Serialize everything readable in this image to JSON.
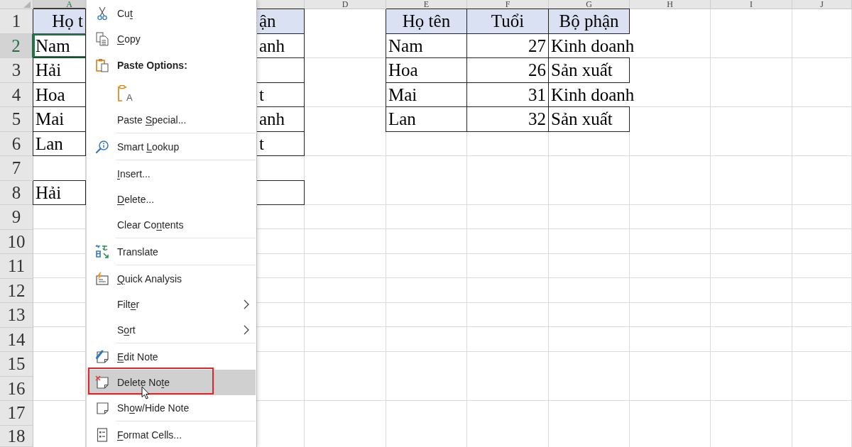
{
  "sheet": {
    "column_headers": [
      {
        "label": "A",
        "selected": true
      },
      {
        "selected": false
      },
      {
        "label": "D",
        "selected": false
      },
      {
        "label": "E",
        "selected": false
      },
      {
        "label": "F",
        "selected": false
      },
      {
        "label": "G",
        "selected": false
      },
      {
        "label": "H",
        "selected": false
      },
      {
        "label": "I",
        "selected": false
      },
      {
        "label": "J",
        "selected": false
      }
    ],
    "rows": [
      {
        "number": "1",
        "selected": false
      },
      {
        "number": "2",
        "selected": true
      },
      {
        "number": "3",
        "selected": false
      },
      {
        "number": "4",
        "selected": false
      },
      {
        "number": "5",
        "selected": false
      },
      {
        "number": "6",
        "selected": false
      },
      {
        "number": "7",
        "selected": false
      },
      {
        "number": "8",
        "selected": false
      },
      {
        "number": "9",
        "selected": false
      },
      {
        "number": "10",
        "selected": false
      },
      {
        "number": "11",
        "selected": false
      },
      {
        "number": "12",
        "selected": false
      },
      {
        "number": "13",
        "selected": false
      },
      {
        "number": "14",
        "selected": false
      },
      {
        "number": "15",
        "selected": false
      },
      {
        "number": "16",
        "selected": false
      },
      {
        "number": "17",
        "selected": false
      },
      {
        "number": "18",
        "selected": false
      }
    ],
    "tables": [
      {
        "rows": [
          {
            "kind": "header",
            "cells": [
              {
                "text": "Họ t",
                "kind": "clipped",
                "selected": false,
                "spills": false
              },
              {
                "text": "ận",
                "kind": "clipped",
                "selected": false,
                "spills": false
              }
            ]
          },
          {
            "kind": "data",
            "cells": [
              {
                "text": "Nam",
                "kind": "text",
                "selected": true,
                "spills": false
              },
              {
                "text": "anh",
                "kind": "clipped",
                "selected": false,
                "spills": false
              }
            ]
          },
          {
            "kind": "data",
            "cells": [
              {
                "text": "Hải",
                "kind": "text",
                "selected": false,
                "spills": false
              }
            ]
          },
          {
            "kind": "data",
            "cells": [
              {
                "text": "Hoa",
                "kind": "text",
                "selected": false,
                "spills": false
              },
              {
                "text": "t",
                "kind": "clipped",
                "selected": false,
                "spills": false
              }
            ]
          },
          {
            "kind": "data",
            "cells": [
              {
                "text": "Mai",
                "kind": "text",
                "selected": false,
                "spills": false
              },
              {
                "text": "anh",
                "kind": "clipped",
                "selected": false,
                "spills": false
              }
            ]
          },
          {
            "kind": "data",
            "cells": [
              {
                "text": "Lan",
                "kind": "text",
                "selected": false,
                "spills": false
              },
              {
                "text": "t",
                "kind": "clipped",
                "selected": false,
                "spills": false
              }
            ]
          }
        ]
      },
      {
        "rows": [
          {
            "kind": "data",
            "cells": [
              {
                "text": "Hải",
                "kind": "text",
                "selected": false,
                "spills": false
              }
            ]
          }
        ]
      },
      {
        "rows": [
          {
            "kind": "header",
            "cells": [
              {
                "text": "Họ tên",
                "kind": "title",
                "selected": false,
                "spills": false
              },
              {
                "text": "Tuổi",
                "kind": "title",
                "selected": false,
                "spills": false
              },
              {
                "text": "Bộ phận",
                "kind": "title",
                "selected": false,
                "spills": false
              }
            ]
          },
          {
            "kind": "data",
            "cells": [
              {
                "text": "Nam",
                "kind": "text",
                "selected": false,
                "spills": false
              },
              {
                "text": "27",
                "kind": "number",
                "selected": false,
                "spills": false
              },
              {
                "text": "Kinh doanh",
                "kind": "text",
                "selected": false,
                "spills": true
              }
            ]
          },
          {
            "kind": "data",
            "cells": [
              {
                "text": "Hoa",
                "kind": "text",
                "selected": false,
                "spills": false
              },
              {
                "text": "26",
                "kind": "number",
                "selected": false,
                "spills": false
              },
              {
                "text": "Sản xuất",
                "kind": "text",
                "selected": false,
                "spills": false
              }
            ]
          },
          {
            "kind": "data",
            "cells": [
              {
                "text": "Mai",
                "kind": "text",
                "selected": false,
                "spills": false
              },
              {
                "text": "31",
                "kind": "number",
                "selected": false,
                "spills": false
              },
              {
                "text": "Kinh doanh",
                "kind": "text",
                "selected": false,
                "spills": true
              }
            ]
          },
          {
            "kind": "data",
            "cells": [
              {
                "text": "Lan",
                "kind": "text",
                "selected": false,
                "spills": false
              },
              {
                "text": "32",
                "kind": "number",
                "selected": false,
                "spills": false
              },
              {
                "text": "Sản xuất",
                "kind": "text",
                "selected": false,
                "spills": false
              }
            ]
          }
        ]
      }
    ]
  },
  "context_menu": {
    "items": [
      {
        "kind": "command",
        "label_start": "Cu",
        "access_key": "t",
        "selected": false,
        "submenu": false,
        "framed": false
      },
      {
        "kind": "command",
        "access_key": "C",
        "label_end": "opy",
        "selected": false,
        "submenu": false,
        "framed": false
      },
      {
        "kind": "heading",
        "label": "Paste Options:"
      },
      {
        "kind": "paste-options",
        "options": [
          {
            "glyph": "A"
          }
        ]
      },
      {
        "kind": "command",
        "label_start": "Paste ",
        "access_key": "S",
        "label_end": "pecial...",
        "selected": false,
        "submenu": false,
        "framed": false
      },
      {
        "kind": "separator"
      },
      {
        "kind": "command",
        "label_start": "Smart ",
        "access_key": "L",
        "label_end": "ookup",
        "selected": false,
        "submenu": false,
        "framed": false
      },
      {
        "kind": "separator"
      },
      {
        "kind": "command",
        "access_key": "I",
        "label_end": "nsert...",
        "selected": false,
        "submenu": false,
        "framed": false
      },
      {
        "kind": "command",
        "access_key": "D",
        "label_end": "elete...",
        "selected": false,
        "submenu": false,
        "framed": false
      },
      {
        "kind": "command",
        "label_start": "Clear Co",
        "access_key": "n",
        "label_end": "tents",
        "selected": false,
        "submenu": false,
        "framed": false
      },
      {
        "kind": "separator"
      },
      {
        "kind": "command",
        "label_start": "Translate",
        "selected": false,
        "submenu": false,
        "framed": false
      },
      {
        "kind": "separator"
      },
      {
        "kind": "command",
        "access_key": "Q",
        "label_end": "uick Analysis",
        "selected": false,
        "submenu": false,
        "framed": false
      },
      {
        "kind": "command",
        "label_start": "Filt",
        "access_key": "e",
        "label_end": "r",
        "selected": false,
        "submenu": true,
        "framed": false
      },
      {
        "kind": "command",
        "label_start": "S",
        "access_key": "o",
        "label_end": "rt",
        "selected": false,
        "submenu": true,
        "framed": false
      },
      {
        "kind": "separator"
      },
      {
        "kind": "command",
        "access_key": "E",
        "label_end": "dit Note",
        "selected": false,
        "submenu": false,
        "framed": false
      },
      {
        "kind": "command",
        "label_start": "Delete No",
        "access_key": "t",
        "label_end": "e",
        "selected": true,
        "submenu": false,
        "framed": true
      },
      {
        "kind": "command",
        "label_start": "Sh",
        "access_key": "o",
        "label_end": "w/Hide Note",
        "selected": false,
        "submenu": false,
        "framed": false
      },
      {
        "kind": "separator"
      },
      {
        "kind": "command",
        "access_key": "F",
        "label_end": "ormat Cells...",
        "selected": false,
        "submenu": false,
        "framed": false
      }
    ]
  }
}
